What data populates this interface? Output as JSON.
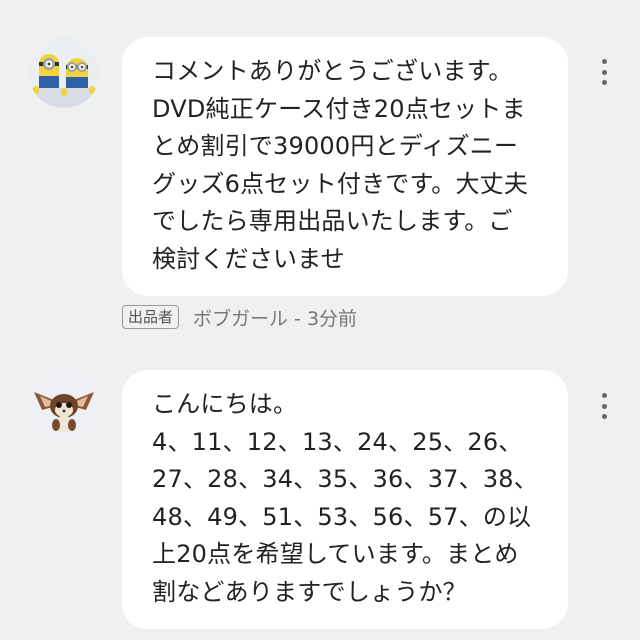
{
  "comments": [
    {
      "avatar_icon": "minion-avatar-icon",
      "lines": [
        "コメントありがとうございます。",
        "DVD純正ケース付き20点セットま",
        "とめ割引で39000円とディズニー",
        "グッズ6点セット付きです。大丈夫",
        "でしたら専用出品いたします。ご",
        "検討くださいませ"
      ],
      "seller_tag": "出品者",
      "author_meta": "ボブガール - 3分前"
    },
    {
      "avatar_icon": "gizmo-avatar-icon",
      "lines": [
        "こんにちは。",
        "4、11、12、13、24、25、26、",
        "27、28、34、35、36、37、38、",
        "48、49、51、53、56、57、の以",
        "上20点を希望しています。まとめ",
        "割などありますでしょうか？"
      ]
    }
  ],
  "menu_icon": "more-vertical-icon"
}
